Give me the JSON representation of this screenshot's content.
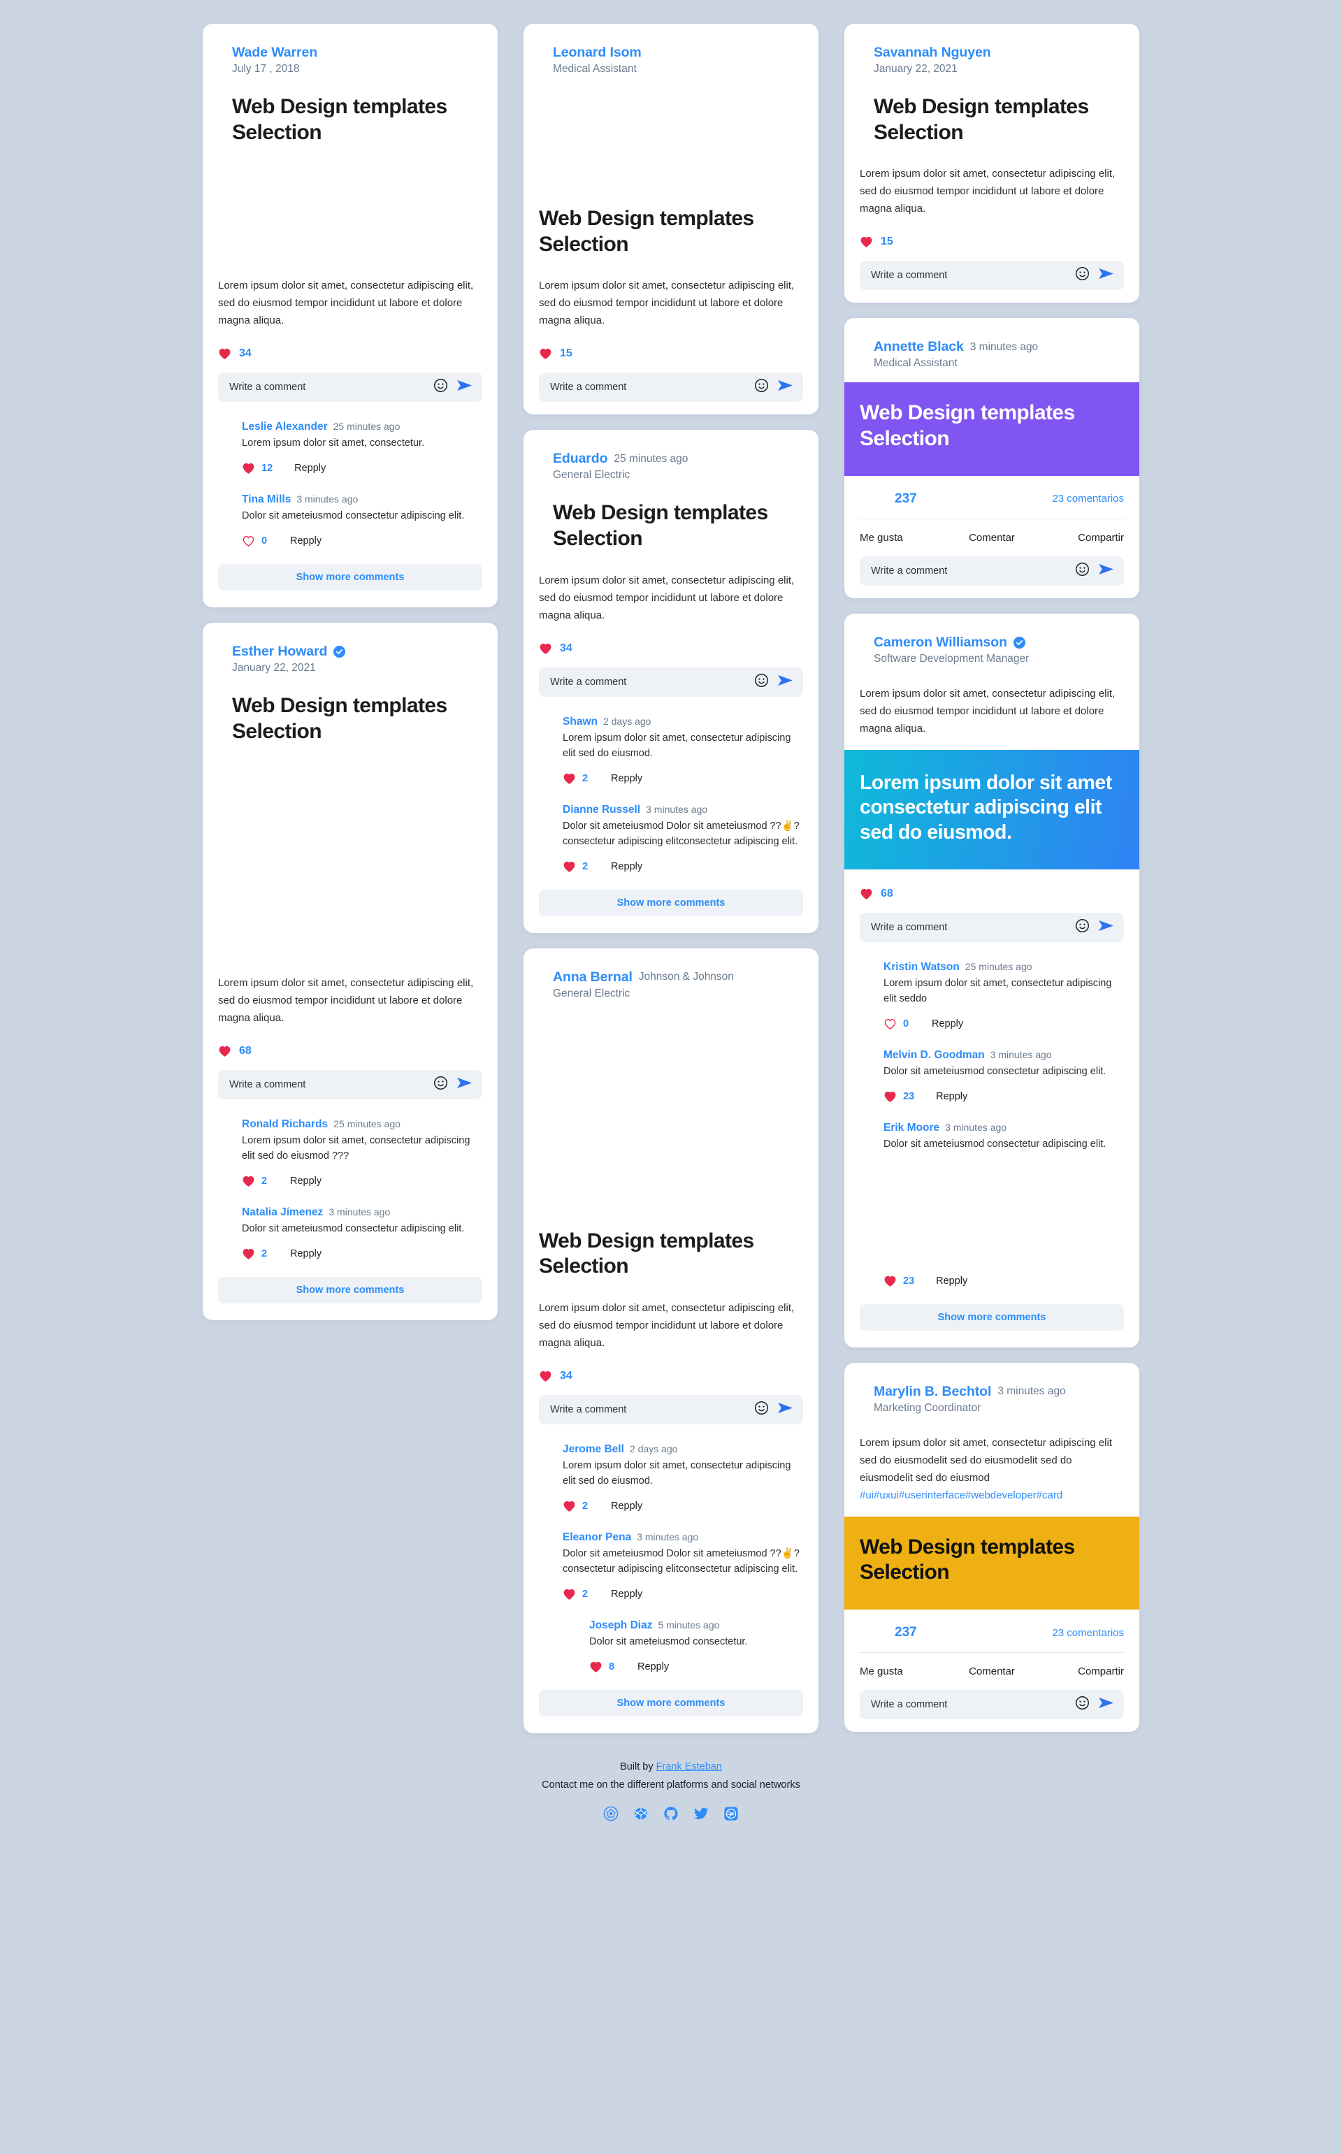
{
  "ui": {
    "comment_placeholder": "Write a comment",
    "show_more_label": "Show more comments",
    "reply_label": "Repply",
    "post_title": "Web Design templates Selection",
    "body_lorem": "Lorem ipsum dolor sit amet, consectetur adipiscing elit, sed do eiusmod tempor incididunt ut labore et dolore magna aliqua.",
    "like_label": "Me gusta",
    "comment_label": "Comentar",
    "share_label": "Compartir",
    "stat_likes": "237",
    "stat_comments": "23 comentarios"
  },
  "colors": {
    "accent_blue": "#2d8cf8",
    "heart_red": "#e8294e",
    "banner_purple": "#8055f2",
    "banner_yellow": "#eeb012",
    "banner_blue_start": "#0fb9d9",
    "banner_blue_end": "#2f82f4",
    "page_bg": "#ccd6e3",
    "input_bg": "#eef2f7"
  },
  "col1": {
    "card1": {
      "author": "Wade Warren",
      "date": "July 17 , 2018",
      "title": "Web Design templates Selection",
      "body": "Lorem ipsum dolor sit amet, consectetur adipiscing elit, sed do eiusmod tempor incididunt ut labore et dolore magna aliqua.",
      "likes": "34",
      "comments": [
        {
          "name": "Leslie Alexander",
          "time": "25 minutes ago",
          "text": "Lorem ipsum dolor sit amet, consectetur.",
          "likes": "12",
          "liked": true,
          "reply": "Repply"
        },
        {
          "name": "Tina Mills",
          "time": "3 minutes ago",
          "text": "Dolor sit ameteiusmod consectetur adipiscing elit.",
          "likes": "0",
          "liked": false,
          "reply": "Repply"
        }
      ],
      "show_more": "Show more comments"
    },
    "card2": {
      "author": "Esther Howard",
      "verified": true,
      "date": "January 22, 2021",
      "title": "Web Design templates Selection",
      "body": "Lorem ipsum dolor sit amet, consectetur adipiscing elit, sed do eiusmod tempor incididunt ut labore et dolore magna aliqua.",
      "likes": "68",
      "comments": [
        {
          "name": "Ronald Richards",
          "time": "25 minutes ago",
          "text": "Lorem ipsum dolor sit amet, consectetur adipiscing elit sed do eiusmod ???",
          "likes": "2",
          "liked": true,
          "reply": "Repply"
        },
        {
          "name": "Natalia Jímenez",
          "time": "3 minutes ago",
          "text": "Dolor sit ameteiusmod consectetur adipiscing elit.",
          "likes": "2",
          "liked": true,
          "reply": "Repply"
        }
      ],
      "show_more": "Show more comments"
    }
  },
  "col2": {
    "card1": {
      "author": "Leonard Isom",
      "role": "Medical Assistant",
      "title": "Web Design templates Selection",
      "body": "Lorem ipsum dolor sit amet, consectetur adipiscing elit, sed do eiusmod tempor incididunt ut labore et dolore magna aliqua.",
      "likes": "15"
    },
    "card2": {
      "author": "Eduardo",
      "time": "25 minutes ago",
      "role": "General Electric",
      "title": "Web Design templates Selection",
      "body": "Lorem ipsum dolor sit amet, consectetur adipiscing elit, sed do eiusmod tempor incididunt ut labore et dolore magna aliqua.",
      "likes": "34",
      "comments": [
        {
          "name": "Shawn",
          "time": "2 days ago",
          "text": "Lorem ipsum dolor sit amet, consectetur adipiscing elit sed do eiusmod.",
          "likes": "2",
          "liked": true,
          "reply": "Repply"
        },
        {
          "name": "Dianne Russell",
          "time": "3 minutes ago",
          "text": "Dolor sit ameteiusmod Dolor sit ameteiusmod ??✌?consectetur adipiscing elitconsectetur adipiscing elit.",
          "likes": "2",
          "liked": true,
          "reply": "Repply"
        }
      ],
      "show_more": "Show more comments"
    },
    "card3": {
      "author": "Anna Bernal",
      "company": "Johnson & Johnson",
      "role": "General Electric",
      "title": "Web Design templates Selection",
      "body": "Lorem ipsum dolor sit amet, consectetur adipiscing elit, sed do eiusmod tempor incididunt ut labore et dolore magna aliqua.",
      "likes": "34",
      "comments": [
        {
          "name": "Jerome Bell",
          "time": "2 days ago",
          "text": "Lorem ipsum dolor sit amet, consectetur adipiscing elit sed do eiusmod.",
          "likes": "2",
          "liked": true,
          "reply": "Repply"
        },
        {
          "name": "Eleanor Pena",
          "time": "3 minutes ago",
          "text": "Dolor sit ameteiusmod Dolor sit ameteiusmod ??✌?consectetur adipiscing elitconsectetur adipiscing elit.",
          "likes": "2",
          "liked": true,
          "reply": "Repply"
        },
        {
          "name": "Joseph Diaz",
          "time": "5 minutes ago",
          "text": "Dolor sit ameteiusmod consectetur.",
          "likes": "8",
          "liked": true,
          "reply": "Repply",
          "nested": true
        }
      ],
      "show_more": "Show more comments"
    }
  },
  "col3": {
    "card1": {
      "author": "Savannah Nguyen",
      "date": "January 22, 2021",
      "title": "Web Design templates Selection",
      "body": "Lorem ipsum dolor sit amet, consectetur adipiscing elit, sed do eiusmod tempor incididunt ut labore et dolore magna aliqua.",
      "likes": "15"
    },
    "card2": {
      "author": "Annette Black",
      "time": "3 minutes ago",
      "role": "Medical Assistant",
      "title": "Web Design templates Selection",
      "stat_likes": "237",
      "stat_comments": "23 comentarios",
      "like_label": "Me gusta",
      "comment_label": "Comentar",
      "share_label": "Compartir"
    },
    "card3": {
      "author": "Cameron Williamson",
      "verified": true,
      "role": "Software Development Manager",
      "body": "Lorem ipsum dolor sit amet, consectetur adipiscing elit, sed do eiusmod tempor incididunt ut labore et dolore magna aliqua.",
      "quote": "Lorem ipsum dolor sit amet consectetur adipiscing elit sed do eiusmod.",
      "likes": "68",
      "comments": [
        {
          "name": "Kristin Watson",
          "time": "25 minutes ago",
          "text": "Lorem ipsum dolor sit amet, consectetur adipiscing elit seddo",
          "likes": "0",
          "liked": false,
          "reply": "Repply"
        },
        {
          "name": "Melvin D. Goodman",
          "time": "3 minutes ago",
          "text": "Dolor sit ameteiusmod consectetur adipiscing elit.",
          "likes": "23",
          "liked": true,
          "reply": "Repply"
        },
        {
          "name": "Erik Moore",
          "time": "3 minutes ago",
          "text": "Dolor sit ameteiusmod consectetur adipiscing elit.",
          "likes": "23",
          "liked": true,
          "reply": "Repply",
          "spacer": true
        }
      ],
      "show_more": "Show more comments"
    },
    "card4": {
      "author": "Marylin B. Bechtol",
      "time": "3 minutes ago",
      "role": "Marketing Coordinator",
      "body": "Lorem ipsum dolor sit amet, consectetur adipiscing elit sed do eiusmodelit sed do eiusmodelit sed do eiusmodelit sed do eiusmod",
      "hashtags": "#ui#uxui#userinterface#webdeveloper#card",
      "title": "Web Design templates Selection",
      "stat_likes": "237",
      "stat_comments": "23 comentarios",
      "like_label": "Me gusta",
      "comment_label": "Comentar",
      "share_label": "Compartir"
    }
  },
  "footer": {
    "built_prefix": "Built by ",
    "built_name": "Frank Esteban",
    "contact": "Contact me on the different platforms and social networks",
    "social": [
      {
        "name": "sketch-icon"
      },
      {
        "name": "codepen-icon"
      },
      {
        "name": "github-icon"
      },
      {
        "name": "twitter-icon"
      },
      {
        "name": "dribbble-icon"
      }
    ]
  }
}
